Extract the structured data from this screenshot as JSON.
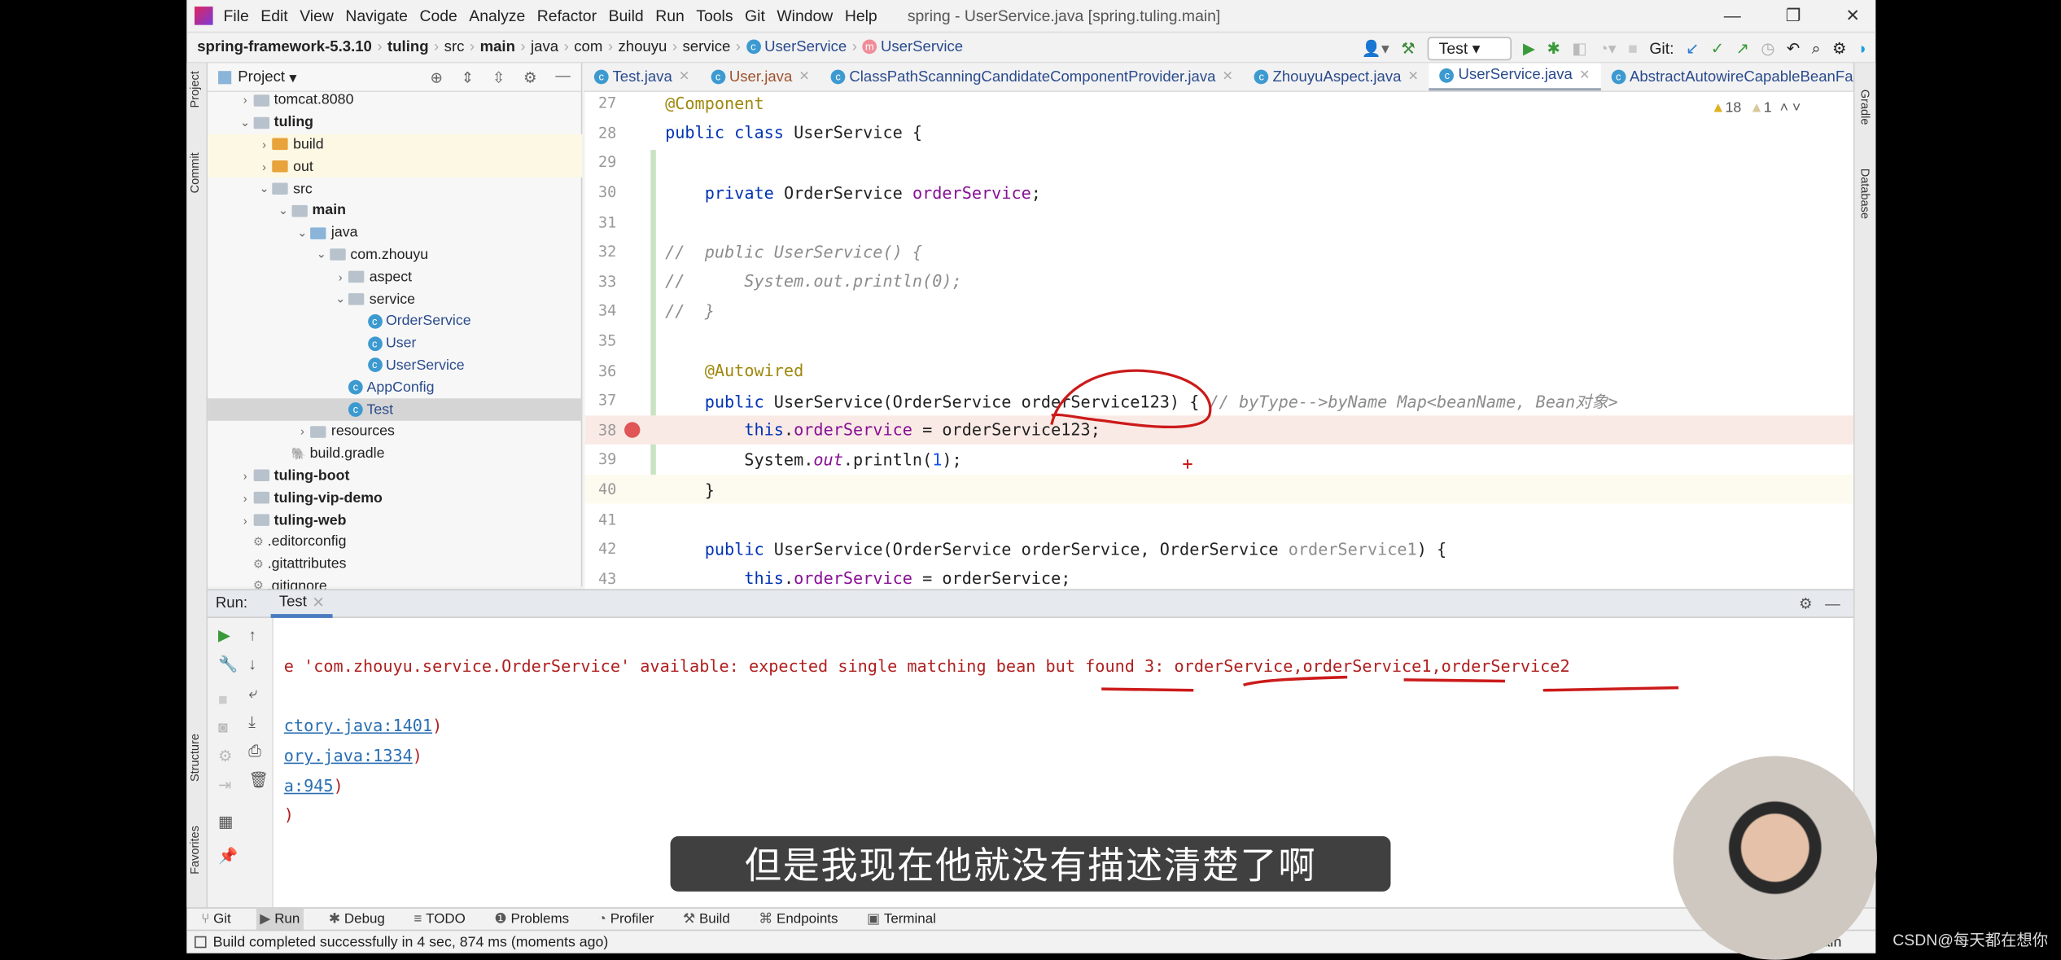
{
  "menu": {
    "items": [
      "File",
      "Edit",
      "View",
      "Navigate",
      "Code",
      "Analyze",
      "Refactor",
      "Build",
      "Run",
      "Tools",
      "Git",
      "Window",
      "Help"
    ],
    "title": "spring - UserService.java [spring.tuling.main]"
  },
  "breadcrumb": [
    "spring-framework-5.3.10",
    "tuling",
    "src",
    "main",
    "java",
    "com",
    "zhouyu",
    "service",
    "UserService",
    "UserService"
  ],
  "toolbar": {
    "run_config": "Test",
    "git_label": "Git:"
  },
  "side_left": {
    "project": "Project",
    "commit": "Commit",
    "structure": "Structure",
    "favorites": "Favorites"
  },
  "side_right": {
    "gradle": "Gradle",
    "database": "Database"
  },
  "project_panel": {
    "title": "Project",
    "tree": [
      {
        "label": "tomcat.8080",
        "depth": 1,
        "type": "folder",
        "arrow": "›"
      },
      {
        "label": "tuling",
        "depth": 1,
        "type": "folder",
        "arrow": "⌄",
        "bold": true
      },
      {
        "label": "build",
        "depth": 2,
        "type": "folder-orange",
        "arrow": "›",
        "hl": true
      },
      {
        "label": "out",
        "depth": 2,
        "type": "folder-orange",
        "arrow": "›",
        "hl": true
      },
      {
        "label": "src",
        "depth": 2,
        "type": "folder",
        "arrow": "⌄"
      },
      {
        "label": "main",
        "depth": 3,
        "type": "folder",
        "arrow": "⌄",
        "bold": true
      },
      {
        "label": "java",
        "depth": 4,
        "type": "folder-blue",
        "arrow": "⌄"
      },
      {
        "label": "com.zhouyu",
        "depth": 5,
        "type": "folder",
        "arrow": "⌄"
      },
      {
        "label": "aspect",
        "depth": 6,
        "type": "folder",
        "arrow": "›"
      },
      {
        "label": "service",
        "depth": 6,
        "type": "folder",
        "arrow": "⌄"
      },
      {
        "label": "OrderService",
        "depth": 7,
        "type": "class",
        "arrow": ""
      },
      {
        "label": "User",
        "depth": 7,
        "type": "class",
        "arrow": ""
      },
      {
        "label": "UserService",
        "depth": 7,
        "type": "class",
        "arrow": ""
      },
      {
        "label": "AppConfig",
        "depth": 6,
        "type": "class",
        "arrow": ""
      },
      {
        "label": "Test",
        "depth": 6,
        "type": "class",
        "arrow": "",
        "sel": true
      },
      {
        "label": "resources",
        "depth": 4,
        "type": "folder",
        "arrow": "›"
      },
      {
        "label": "build.gradle",
        "depth": 3,
        "type": "gradle",
        "arrow": ""
      },
      {
        "label": "tuling-boot",
        "depth": 1,
        "type": "folder",
        "arrow": "›",
        "bold": true
      },
      {
        "label": "tuling-vip-demo",
        "depth": 1,
        "type": "folder",
        "arrow": "›",
        "bold": true
      },
      {
        "label": "tuling-web",
        "depth": 1,
        "type": "folder",
        "arrow": "›",
        "bold": true
      },
      {
        "label": ".editorconfig",
        "depth": 1,
        "type": "file",
        "arrow": ""
      },
      {
        "label": ".gitattributes",
        "depth": 1,
        "type": "file",
        "arrow": ""
      },
      {
        "label": ".gitignore",
        "depth": 1,
        "type": "file",
        "arrow": ""
      }
    ]
  },
  "editor_tabs": [
    {
      "label": "Test.java"
    },
    {
      "label": "User.java",
      "orange": true
    },
    {
      "label": "ClassPathScanningCandidateComponentProvider.java"
    },
    {
      "label": "ZhouyuAspect.java"
    },
    {
      "label": "UserService.java",
      "active": true
    },
    {
      "label": "AbstractAutowireCapableBeanFactory.j"
    }
  ],
  "inspections": {
    "warnings": "18",
    "weak_warnings": "1"
  },
  "code_lines": [
    {
      "n": "27",
      "t": [
        [
          "an",
          "@Component"
        ]
      ]
    },
    {
      "n": "28",
      "t": [
        [
          "kw",
          "public class "
        ],
        [
          "",
          "UserService {"
        ]
      ]
    },
    {
      "n": "29",
      "t": []
    },
    {
      "n": "30",
      "t": [
        [
          "",
          "    "
        ],
        [
          "kw",
          "private "
        ],
        [
          "",
          "OrderService "
        ],
        [
          "fd",
          "orderService"
        ],
        [
          "",
          ";"
        ]
      ]
    },
    {
      "n": "31",
      "t": []
    },
    {
      "n": "32",
      "t": [
        [
          "cm",
          "//  public UserService() {"
        ]
      ]
    },
    {
      "n": "33",
      "t": [
        [
          "cm",
          "//      System.out.println(0);"
        ]
      ]
    },
    {
      "n": "34",
      "t": [
        [
          "cm",
          "//  }"
        ]
      ]
    },
    {
      "n": "35",
      "t": []
    },
    {
      "n": "36",
      "t": [
        [
          "",
          "    "
        ],
        [
          "an",
          "@Autowired"
        ]
      ]
    },
    {
      "n": "37",
      "t": [
        [
          "",
          "    "
        ],
        [
          "kw",
          "public "
        ],
        [
          "",
          "UserService(OrderService orderService123) { "
        ],
        [
          "cm",
          "// byType-->byName Map<beanName, Bean对象>"
        ]
      ]
    },
    {
      "n": "38",
      "t": [
        [
          "",
          "        "
        ],
        [
          "kw",
          "this"
        ],
        [
          "",
          "."
        ],
        [
          "fd",
          "orderService"
        ],
        [
          "",
          " = orderService123;"
        ]
      ],
      "bp": true
    },
    {
      "n": "39",
      "t": [
        [
          "",
          "        System."
        ],
        [
          "it",
          "out"
        ],
        [
          "",
          ".println("
        ],
        [
          "num",
          "1"
        ],
        [
          "",
          ");"
        ]
      ]
    },
    {
      "n": "40",
      "t": [
        [
          "",
          "    }"
        ]
      ],
      "cur": true
    },
    {
      "n": "41",
      "t": []
    },
    {
      "n": "42",
      "t": [
        [
          "",
          "    "
        ],
        [
          "kw",
          "public "
        ],
        [
          "",
          "UserService(OrderService orderService, OrderService "
        ],
        [
          "gr",
          "orderService1"
        ],
        [
          "",
          ") {"
        ]
      ]
    },
    {
      "n": "43",
      "t": [
        [
          "",
          "        "
        ],
        [
          "kw",
          "this"
        ],
        [
          "",
          "."
        ],
        [
          "fd",
          "orderService"
        ],
        [
          "",
          " = orderService;"
        ]
      ]
    }
  ],
  "run_panel": {
    "label": "Run:",
    "tab": "Test",
    "lines": [
      {
        "text": "e 'com.zhouyu.service.OrderService' available: expected single matching bean but found 3: orderService,orderService1,orderService2",
        "link": "",
        "tail": ""
      },
      {
        "text": "",
        "link": "ctory.java:1401",
        "tail": ")"
      },
      {
        "text": "",
        "link": "ory.java:1334",
        "tail": ")"
      },
      {
        "text": "",
        "link": "a:945",
        "tail": ")"
      },
      {
        "text": "",
        "link": "",
        "tail": ")"
      }
    ]
  },
  "bottom_tabs": [
    {
      "label": "Git",
      "icon": "git-icon"
    },
    {
      "label": "Run",
      "icon": "play-icon",
      "active": true
    },
    {
      "label": "Debug",
      "icon": "bug-icon"
    },
    {
      "label": "TODO",
      "icon": "list-icon"
    },
    {
      "label": "Problems",
      "icon": "problems-icon"
    },
    {
      "label": "Profiler",
      "icon": "profiler-icon"
    },
    {
      "label": "Build",
      "icon": "hammer-icon"
    },
    {
      "label": "Endpoints",
      "icon": "endpoints-icon"
    },
    {
      "label": "Terminal",
      "icon": "terminal-icon"
    }
  ],
  "status": {
    "message": "Build completed successfully in 4 sec, 874 ms (moments ago)",
    "branch": "main"
  },
  "subtitle": "但是我现在他就没有描述清楚了啊",
  "watermark": "CSDN@每天都在想你",
  "colors": {
    "keyword": "#0033b3",
    "annotation": "#9e880d",
    "field": "#871094",
    "comment": "#8c8c8c",
    "error": "#b02020",
    "ink": "#cc1a1a"
  }
}
